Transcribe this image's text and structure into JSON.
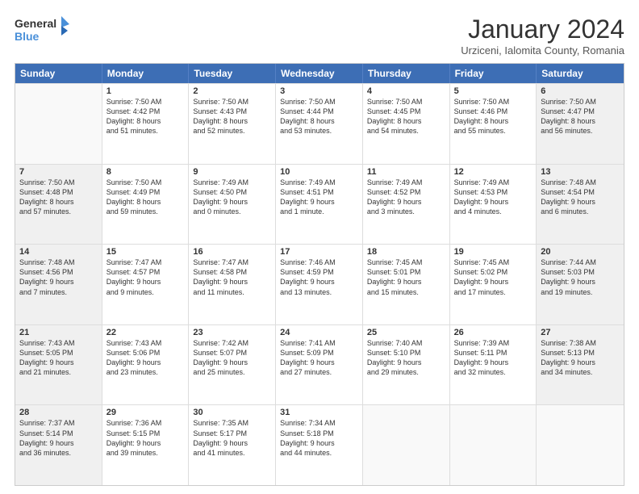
{
  "logo": {
    "line1": "General",
    "line2": "Blue"
  },
  "title": "January 2024",
  "subtitle": "Urziceni, Ialomita County, Romania",
  "days_of_week": [
    "Sunday",
    "Monday",
    "Tuesday",
    "Wednesday",
    "Thursday",
    "Friday",
    "Saturday"
  ],
  "weeks": [
    [
      {
        "day": "",
        "content": ""
      },
      {
        "day": "1",
        "content": "Sunrise: 7:50 AM\nSunset: 4:42 PM\nDaylight: 8 hours\nand 51 minutes."
      },
      {
        "day": "2",
        "content": "Sunrise: 7:50 AM\nSunset: 4:43 PM\nDaylight: 8 hours\nand 52 minutes."
      },
      {
        "day": "3",
        "content": "Sunrise: 7:50 AM\nSunset: 4:44 PM\nDaylight: 8 hours\nand 53 minutes."
      },
      {
        "day": "4",
        "content": "Sunrise: 7:50 AM\nSunset: 4:45 PM\nDaylight: 8 hours\nand 54 minutes."
      },
      {
        "day": "5",
        "content": "Sunrise: 7:50 AM\nSunset: 4:46 PM\nDaylight: 8 hours\nand 55 minutes."
      },
      {
        "day": "6",
        "content": "Sunrise: 7:50 AM\nSunset: 4:47 PM\nDaylight: 8 hours\nand 56 minutes."
      }
    ],
    [
      {
        "day": "7",
        "content": "Sunrise: 7:50 AM\nSunset: 4:48 PM\nDaylight: 8 hours\nand 57 minutes."
      },
      {
        "day": "8",
        "content": "Sunrise: 7:50 AM\nSunset: 4:49 PM\nDaylight: 8 hours\nand 59 minutes."
      },
      {
        "day": "9",
        "content": "Sunrise: 7:49 AM\nSunset: 4:50 PM\nDaylight: 9 hours\nand 0 minutes."
      },
      {
        "day": "10",
        "content": "Sunrise: 7:49 AM\nSunset: 4:51 PM\nDaylight: 9 hours\nand 1 minute."
      },
      {
        "day": "11",
        "content": "Sunrise: 7:49 AM\nSunset: 4:52 PM\nDaylight: 9 hours\nand 3 minutes."
      },
      {
        "day": "12",
        "content": "Sunrise: 7:49 AM\nSunset: 4:53 PM\nDaylight: 9 hours\nand 4 minutes."
      },
      {
        "day": "13",
        "content": "Sunrise: 7:48 AM\nSunset: 4:54 PM\nDaylight: 9 hours\nand 6 minutes."
      }
    ],
    [
      {
        "day": "14",
        "content": "Sunrise: 7:48 AM\nSunset: 4:56 PM\nDaylight: 9 hours\nand 7 minutes."
      },
      {
        "day": "15",
        "content": "Sunrise: 7:47 AM\nSunset: 4:57 PM\nDaylight: 9 hours\nand 9 minutes."
      },
      {
        "day": "16",
        "content": "Sunrise: 7:47 AM\nSunset: 4:58 PM\nDaylight: 9 hours\nand 11 minutes."
      },
      {
        "day": "17",
        "content": "Sunrise: 7:46 AM\nSunset: 4:59 PM\nDaylight: 9 hours\nand 13 minutes."
      },
      {
        "day": "18",
        "content": "Sunrise: 7:45 AM\nSunset: 5:01 PM\nDaylight: 9 hours\nand 15 minutes."
      },
      {
        "day": "19",
        "content": "Sunrise: 7:45 AM\nSunset: 5:02 PM\nDaylight: 9 hours\nand 17 minutes."
      },
      {
        "day": "20",
        "content": "Sunrise: 7:44 AM\nSunset: 5:03 PM\nDaylight: 9 hours\nand 19 minutes."
      }
    ],
    [
      {
        "day": "21",
        "content": "Sunrise: 7:43 AM\nSunset: 5:05 PM\nDaylight: 9 hours\nand 21 minutes."
      },
      {
        "day": "22",
        "content": "Sunrise: 7:43 AM\nSunset: 5:06 PM\nDaylight: 9 hours\nand 23 minutes."
      },
      {
        "day": "23",
        "content": "Sunrise: 7:42 AM\nSunset: 5:07 PM\nDaylight: 9 hours\nand 25 minutes."
      },
      {
        "day": "24",
        "content": "Sunrise: 7:41 AM\nSunset: 5:09 PM\nDaylight: 9 hours\nand 27 minutes."
      },
      {
        "day": "25",
        "content": "Sunrise: 7:40 AM\nSunset: 5:10 PM\nDaylight: 9 hours\nand 29 minutes."
      },
      {
        "day": "26",
        "content": "Sunrise: 7:39 AM\nSunset: 5:11 PM\nDaylight: 9 hours\nand 32 minutes."
      },
      {
        "day": "27",
        "content": "Sunrise: 7:38 AM\nSunset: 5:13 PM\nDaylight: 9 hours\nand 34 minutes."
      }
    ],
    [
      {
        "day": "28",
        "content": "Sunrise: 7:37 AM\nSunset: 5:14 PM\nDaylight: 9 hours\nand 36 minutes."
      },
      {
        "day": "29",
        "content": "Sunrise: 7:36 AM\nSunset: 5:15 PM\nDaylight: 9 hours\nand 39 minutes."
      },
      {
        "day": "30",
        "content": "Sunrise: 7:35 AM\nSunset: 5:17 PM\nDaylight: 9 hours\nand 41 minutes."
      },
      {
        "day": "31",
        "content": "Sunrise: 7:34 AM\nSunset: 5:18 PM\nDaylight: 9 hours\nand 44 minutes."
      },
      {
        "day": "",
        "content": ""
      },
      {
        "day": "",
        "content": ""
      },
      {
        "day": "",
        "content": ""
      }
    ]
  ]
}
